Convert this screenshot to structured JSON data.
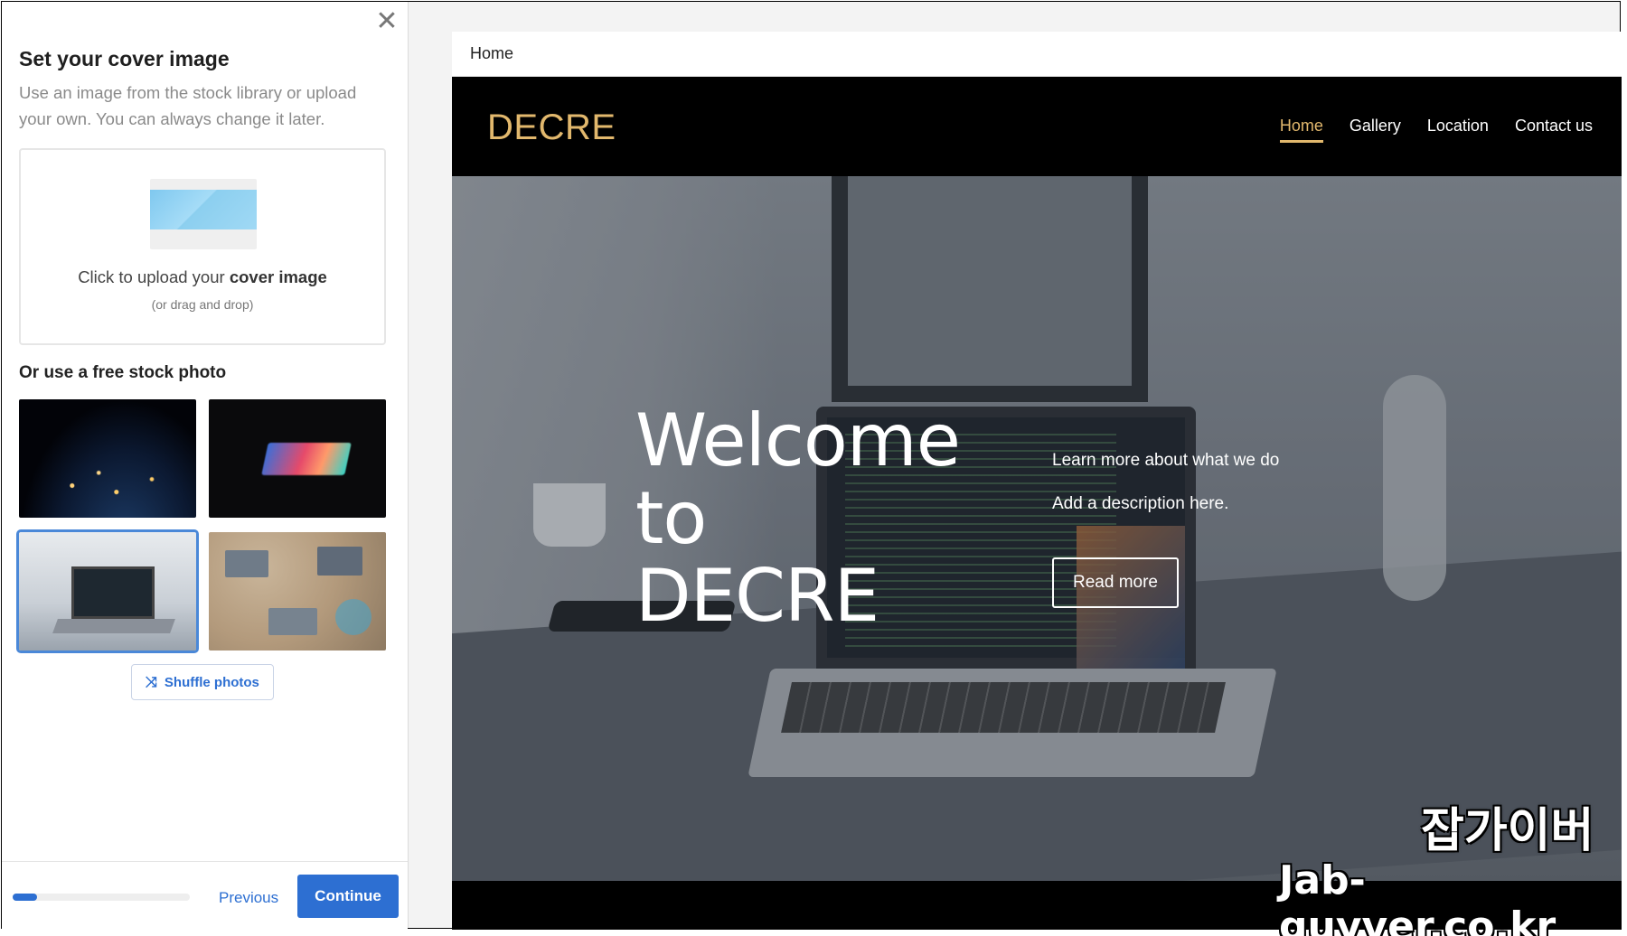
{
  "panel": {
    "close_glyph": "✕",
    "title": "Set your cover image",
    "description": "Use an image from the stock library or upload your own. You can always change it later.",
    "upload": {
      "text_prefix": "Click to upload your ",
      "text_bold": "cover image",
      "subtext": "(or drag and drop)"
    },
    "stock_title": "Or use a free stock photo",
    "stock_photos": [
      {
        "icon": "earth-night-photo",
        "selected": false
      },
      {
        "icon": "glowing-laptop-photo",
        "selected": false
      },
      {
        "icon": "desk-laptop-photo",
        "selected": true
      },
      {
        "icon": "team-workspace-photo",
        "selected": false
      }
    ],
    "shuffle_label": "Shuffle photos",
    "shuffle_icon": "⤨",
    "footer": {
      "progress": 0.14,
      "previous_label": "Previous",
      "continue_label": "Continue"
    }
  },
  "preview": {
    "tab_label": "Home",
    "site": {
      "logo": "DECRE",
      "nav": [
        {
          "label": "Home",
          "active": true
        },
        {
          "label": "Gallery",
          "active": false
        },
        {
          "label": "Location",
          "active": false
        },
        {
          "label": "Contact us",
          "active": false
        }
      ],
      "hero": {
        "title_line1": "Welcome",
        "title_line2": "to DECRE",
        "description_line1": "Learn more about what we do",
        "description_line2": "Add a description here.",
        "button_label": "Read more"
      }
    }
  },
  "watermark": {
    "korean": "잡가이버",
    "url": "Jab-guyver.co.kr"
  },
  "colors": {
    "accent": "#2d6fd2",
    "brand_gold": "#e2b86d",
    "selected_outline": "#4a88d8"
  }
}
